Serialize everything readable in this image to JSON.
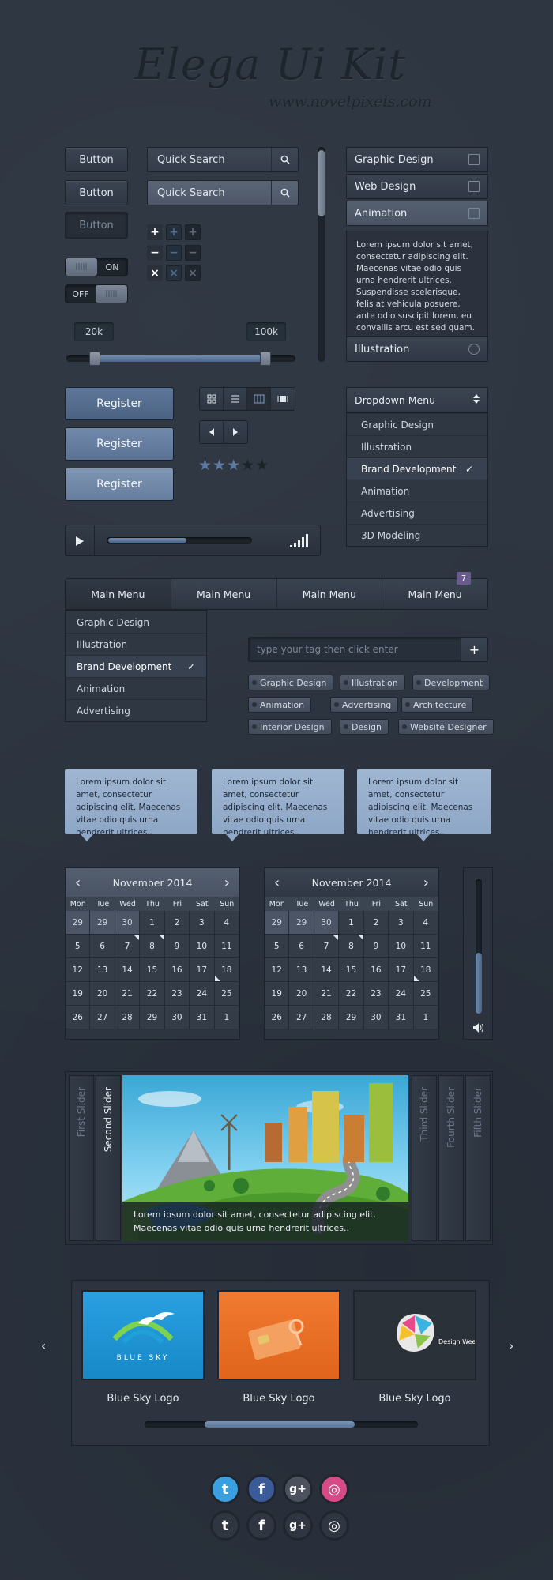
{
  "header": {
    "title": "Elega Ui Kit",
    "subtitle": "www.novelpixels.com"
  },
  "buttons": {
    "b1": "Button",
    "b2": "Button",
    "b3": "Button"
  },
  "search": {
    "placeholder1": "Quick Search",
    "placeholder2": "Quick Search"
  },
  "toggles": {
    "on_label": "ON",
    "off_label": "OFF"
  },
  "steppers": {
    "plus": "+",
    "minus": "−",
    "close": "×"
  },
  "range": {
    "min_label": "20k",
    "max_label": "100k"
  },
  "accordion": {
    "items": [
      "Graphic Design",
      "Web Design",
      "Animation"
    ],
    "body": "Lorem ipsum dolor sit amet, consectetur adipiscing elit. Maecenas vitae odio quis urna hendrerit ultrices. Suspendisse scelerisque, felis at vehicula posuere, ante odio suscipit lorem, eu convallis arcu est sed quam.",
    "last": "Illustration"
  },
  "register": {
    "r1": "Register",
    "r2": "Register",
    "r3": "Register"
  },
  "rating": {
    "value": 3,
    "max": 5
  },
  "dropdown": {
    "title": "Dropdown Menu",
    "items": [
      "Graphic Design",
      "Illustration",
      "Brand Development",
      "Animation",
      "Advertising",
      "3D Modeling"
    ],
    "selected_index": 2
  },
  "player": {
    "progress": 0.55
  },
  "mainmenu": {
    "items": [
      "Main Menu",
      "Main Menu",
      "Main Menu",
      "Main Menu"
    ],
    "badge": "7",
    "submenu": [
      "Graphic Design",
      "Illustration",
      "Brand Development",
      "Animation",
      "Advertising"
    ],
    "selected_index": 2
  },
  "tags": {
    "input_placeholder": "type your tag then click enter",
    "add": "+",
    "items": [
      "Graphic Design",
      "Illustration",
      "Development",
      "Animation",
      "Advertising",
      "Architecture",
      "Interior Design",
      "Design",
      "Website Designer"
    ]
  },
  "tooltips": {
    "text1": "Lorem ipsum dolor sit amet, consectetur adipiscing elit. Maecenas vitae odio quis urna hendrerit ultrices..",
    "text2": "Lorem ipsum dolor sit amet, consectetur adipiscing elit. Maecenas vitae odio quis urna hendrerit ultrices..",
    "text3": "Lorem ipsum dolor sit amet, consectetur adipiscing elit. Maecenas vitae odio quis urna hendrerit ultrices.."
  },
  "calendar": {
    "month": "November 2014",
    "prev": "‹",
    "next": "›",
    "dow": [
      "Mon",
      "Tue",
      "Wed",
      "Thu",
      "Fri",
      "Sat",
      "Sun"
    ],
    "days": [
      "29",
      "29",
      "30",
      "1",
      "2",
      "3",
      "4",
      "5",
      "6",
      "7",
      "8",
      "9",
      "10",
      "11",
      "12",
      "13",
      "14",
      "15",
      "16",
      "17",
      "18",
      "19",
      "20",
      "21",
      "22",
      "23",
      "24",
      "25",
      "26",
      "27",
      "28",
      "29",
      "30",
      "31",
      "1"
    ]
  },
  "volume": {
    "level": 0.45
  },
  "slider": {
    "tabs": [
      "First Slider",
      "Second Slider",
      "Third Slider",
      "Fourth Slider",
      "Fifth Slider"
    ],
    "active": 1,
    "caption": "Lorem ipsum dolor sit amet, consectetur adipiscing elit. Maecenas vitae odio quis urna hendrerit ultrices.."
  },
  "carousel": {
    "items": [
      "Blue Sky Logo",
      "Blue Sky Logo",
      "Blue Sky Logo"
    ],
    "logo_text": "BLUE SKY",
    "logo3_text": "Design Week",
    "prev": "‹",
    "next": "›"
  },
  "social": {
    "twitter": "t",
    "facebook": "f",
    "gplus": "g+",
    "dribbble": "◎"
  },
  "colors": {
    "accent": "#5f7799",
    "background": "#2c3440",
    "badge": "#6a5b8d",
    "tooltip": "#9fb6d2"
  }
}
